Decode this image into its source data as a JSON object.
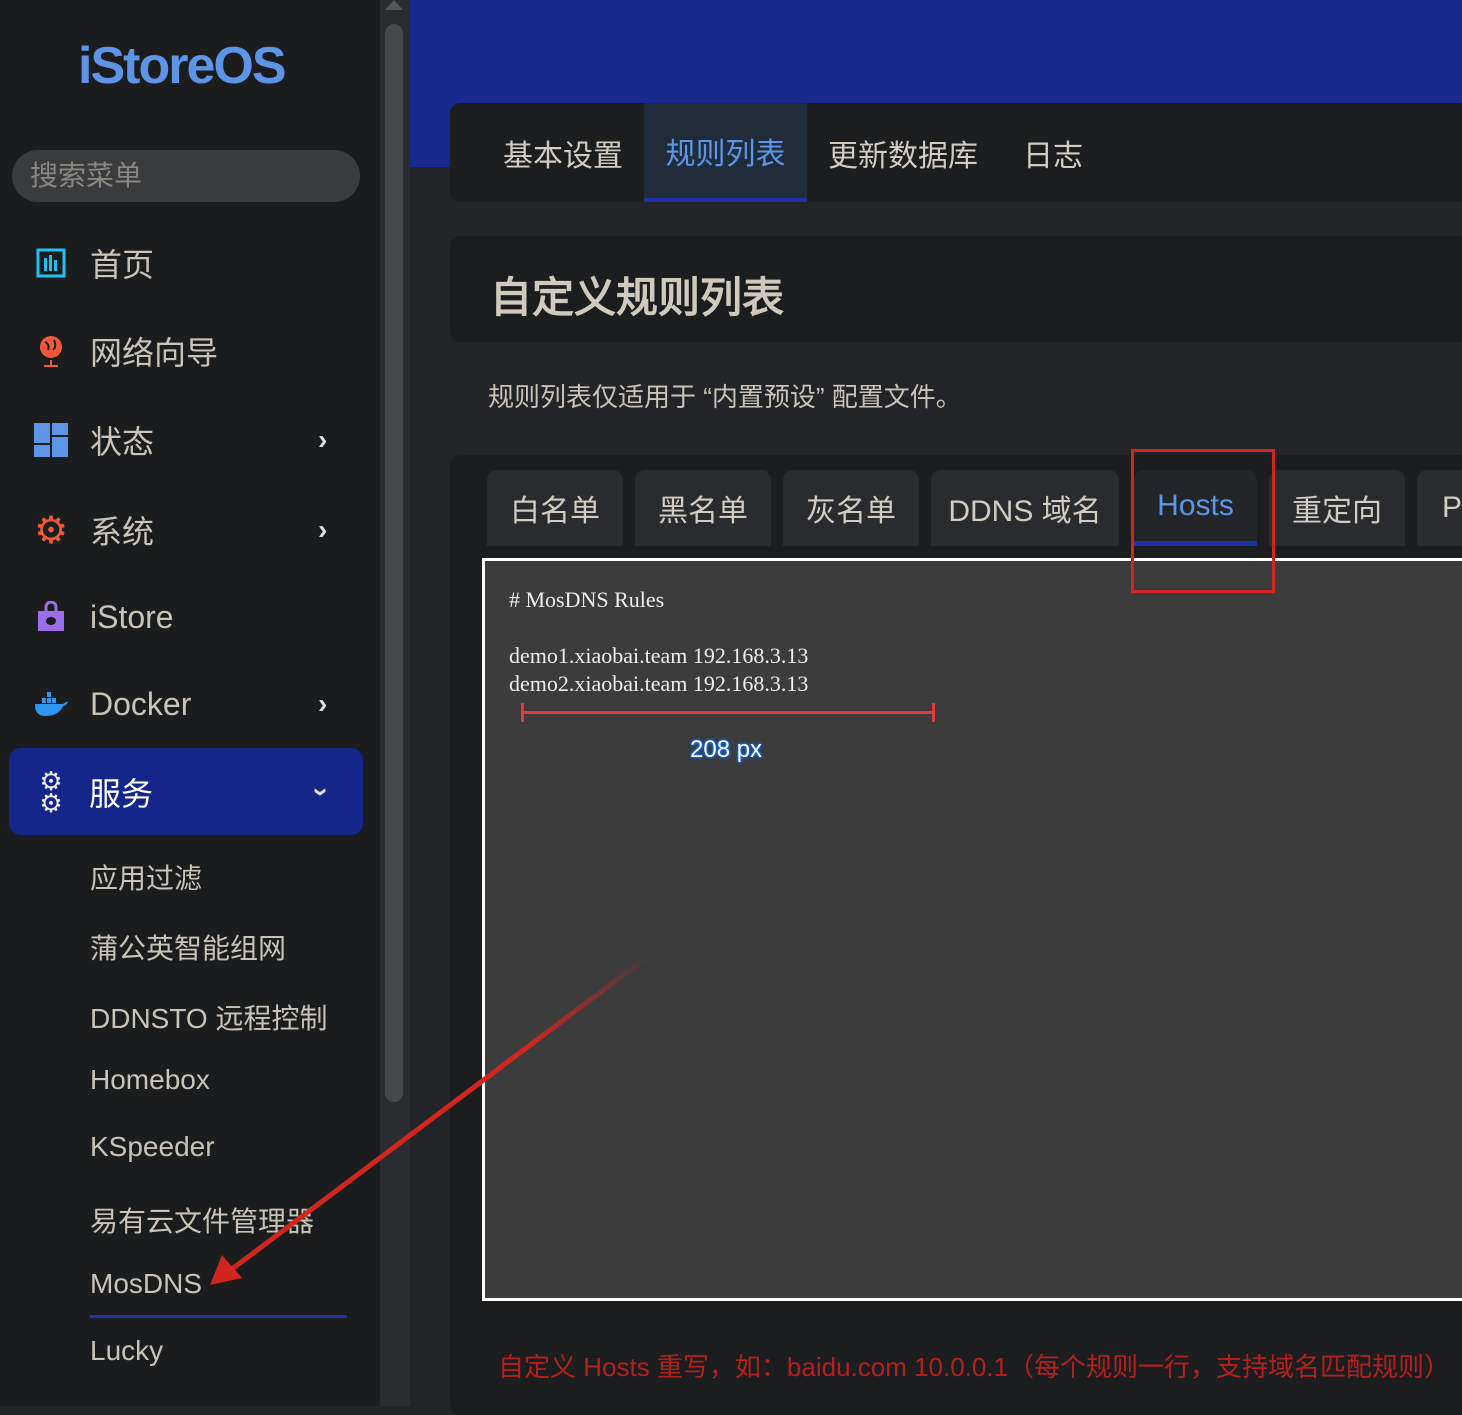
{
  "logo": "iStoreOS",
  "search": {
    "placeholder": "搜索菜单"
  },
  "nav": [
    {
      "label": "首页",
      "icon": "dashboard-icon"
    },
    {
      "label": "网络向导",
      "icon": "globe-icon"
    },
    {
      "label": "状态",
      "icon": "grid-icon"
    },
    {
      "label": "系统",
      "icon": "gear-icon"
    },
    {
      "label": "iStore",
      "icon": "shopping-bag-icon"
    },
    {
      "label": "Docker",
      "icon": "docker-icon"
    },
    {
      "label": "服务",
      "icon": "gears-icon"
    }
  ],
  "services": [
    "应用过滤",
    "蒲公英智能组网",
    "DDNSTO 远程控制",
    "Homebox",
    "KSpeeder",
    "易有云文件管理器",
    "MosDNS",
    "Lucky"
  ],
  "top_tabs": [
    "基本设置",
    "规则列表",
    "更新数据库",
    "日志"
  ],
  "page_title": "自定义规则列表",
  "description": "规则列表仅适用于 “内置预设” 配置文件。",
  "rule_tabs": [
    "白名单",
    "黑名单",
    "灰名单",
    "DDNS 域名",
    "Hosts",
    "重定向",
    "PT"
  ],
  "editor_value": "# MosDNS Rules\n\ndemo1.xiaobai.team 192.168.3.13\ndemo2.xiaobai.team 192.168.3.13",
  "hint": "自定义 Hosts 重写，如：baidu.com 10.0.0.1（每个规则一行，支持域名匹配规则）",
  "annotation": {
    "measure_label": "208 px"
  },
  "colors": {
    "accent": "#5c96e8",
    "active_bg": "#15268a",
    "annotation": "#d0261f"
  }
}
